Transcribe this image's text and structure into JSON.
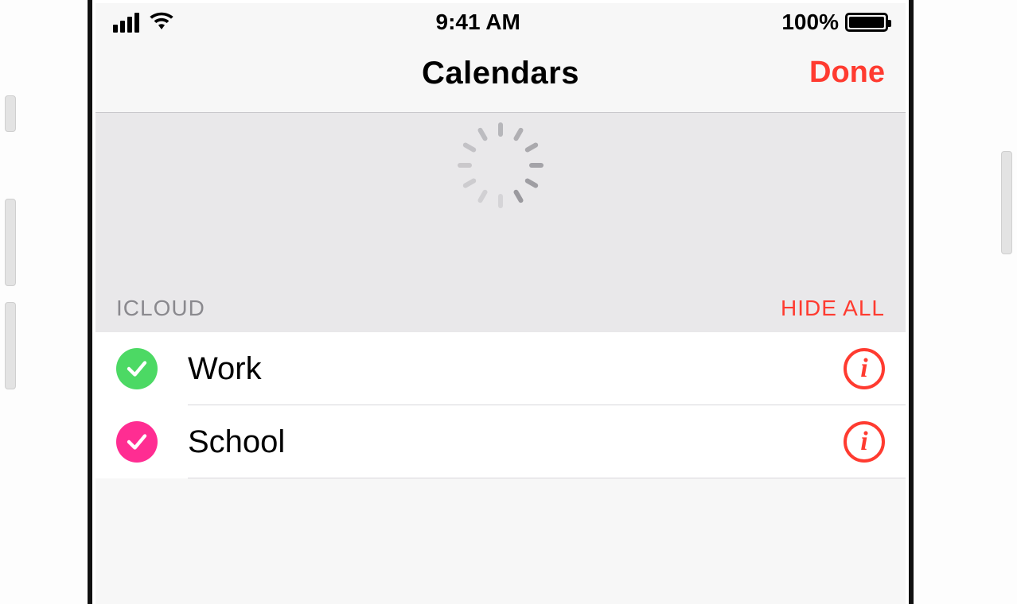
{
  "status_bar": {
    "time": "9:41 AM",
    "battery_pct": "100%"
  },
  "nav": {
    "title": "Calendars",
    "done_label": "Done"
  },
  "section": {
    "label": "ICLOUD",
    "hide_all_label": "HIDE ALL"
  },
  "calendars": [
    {
      "name": "Work",
      "color": "#4cd964",
      "checked": true
    },
    {
      "name": "School",
      "color": "#ff2d92",
      "checked": true
    }
  ],
  "info_glyph": "i",
  "colors": {
    "accent": "#ff3b30"
  }
}
